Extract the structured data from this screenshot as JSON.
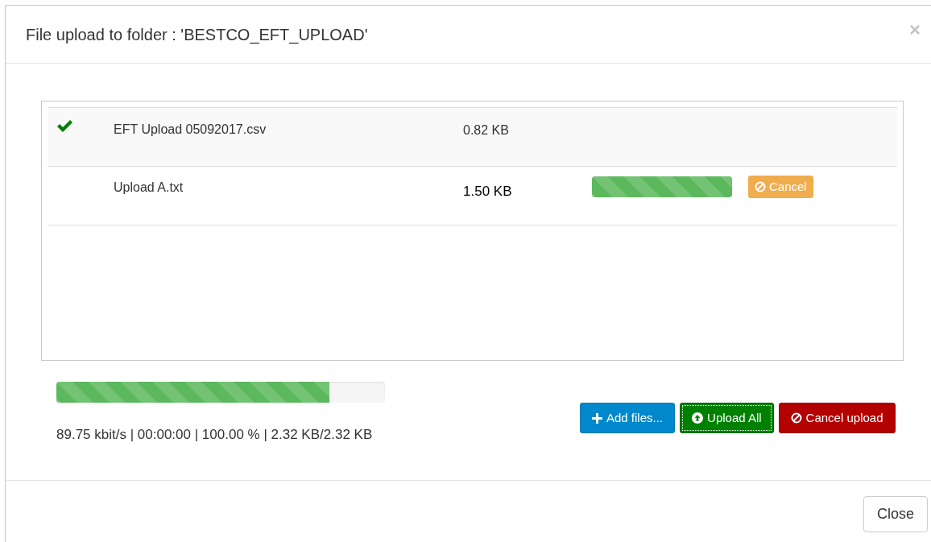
{
  "dialog": {
    "title": "File upload to folder : 'BESTCO_EFT_UPLOAD'",
    "close_glyph": "×"
  },
  "files": [
    {
      "kind": "done",
      "name": "EFT Upload 05092017.csv",
      "size": "0.82 KB"
    },
    {
      "kind": "uploading",
      "name": "Upload A.txt",
      "size": "1.50 KB",
      "level": 1,
      "cancel_label": "Cancel"
    }
  ],
  "overall": {
    "level": 0.83,
    "stats": "89.75 kbit/s | 00:00:00 | 100.00 % | 2.32 KB/2.32 KB"
  },
  "buttons": [
    {
      "kind": "add",
      "label": "Add files..."
    },
    {
      "kind": "upload",
      "label": "Upload All"
    },
    {
      "kind": "cancel",
      "label": "Cancel upload"
    }
  ],
  "footer": {
    "close_label": "Close"
  }
}
